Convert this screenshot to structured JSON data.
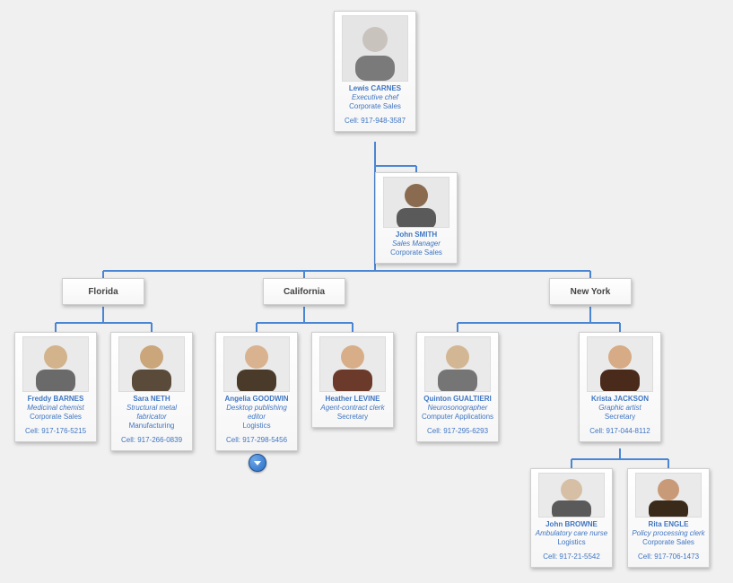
{
  "root": {
    "name": "Lewis CARNES",
    "title": "Executive chef",
    "dept": "Corporate Sales",
    "cell": "Cell: 917-948-3587"
  },
  "manager": {
    "name": "John SMITH",
    "title": "Sales Manager",
    "dept": "Corporate Sales"
  },
  "regions": {
    "florida": {
      "label": "Florida"
    },
    "california": {
      "label": "California"
    },
    "newyork": {
      "label": "New York"
    }
  },
  "florida": {
    "left": {
      "name": "Freddy BARNES",
      "title": "Medicinal chemist",
      "dept": "Corporate Sales",
      "cell": "Cell: 917-176-5215"
    },
    "right": {
      "name": "Sara NETH",
      "title": "Structural metal fabricator",
      "dept": "Manufacturing",
      "cell": "Cell: 917-266-0839"
    }
  },
  "california": {
    "left": {
      "name": "Angelia GOODWIN",
      "title": "Desktop publishing editor",
      "dept": "Logistics",
      "cell": "Cell: 917-298-5456"
    },
    "right": {
      "name": "Heather LEVINE",
      "title": "Agent-contract clerk",
      "dept": "Secretary"
    }
  },
  "newyork": {
    "left": {
      "name": "Quinton GUALTIERI",
      "title": "Neurosonographer",
      "dept": "Computer Applications",
      "cell": "Cell: 917-295-6293"
    },
    "right": {
      "name": "Krista JACKSON",
      "title": "Graphic artist",
      "dept": "Secretary",
      "cell": "Cell: 917-044-8112"
    }
  },
  "krista_children": {
    "left": {
      "name": "John BROWNE",
      "title": "Ambulatory care nurse",
      "dept": "Logistics",
      "cell": "Cell: 917-21-5542"
    },
    "right": {
      "name": "Rita ENGLE",
      "title": "Policy processing clerk",
      "dept": "Corporate Sales",
      "cell": "Cell: 917-706-1473"
    }
  }
}
